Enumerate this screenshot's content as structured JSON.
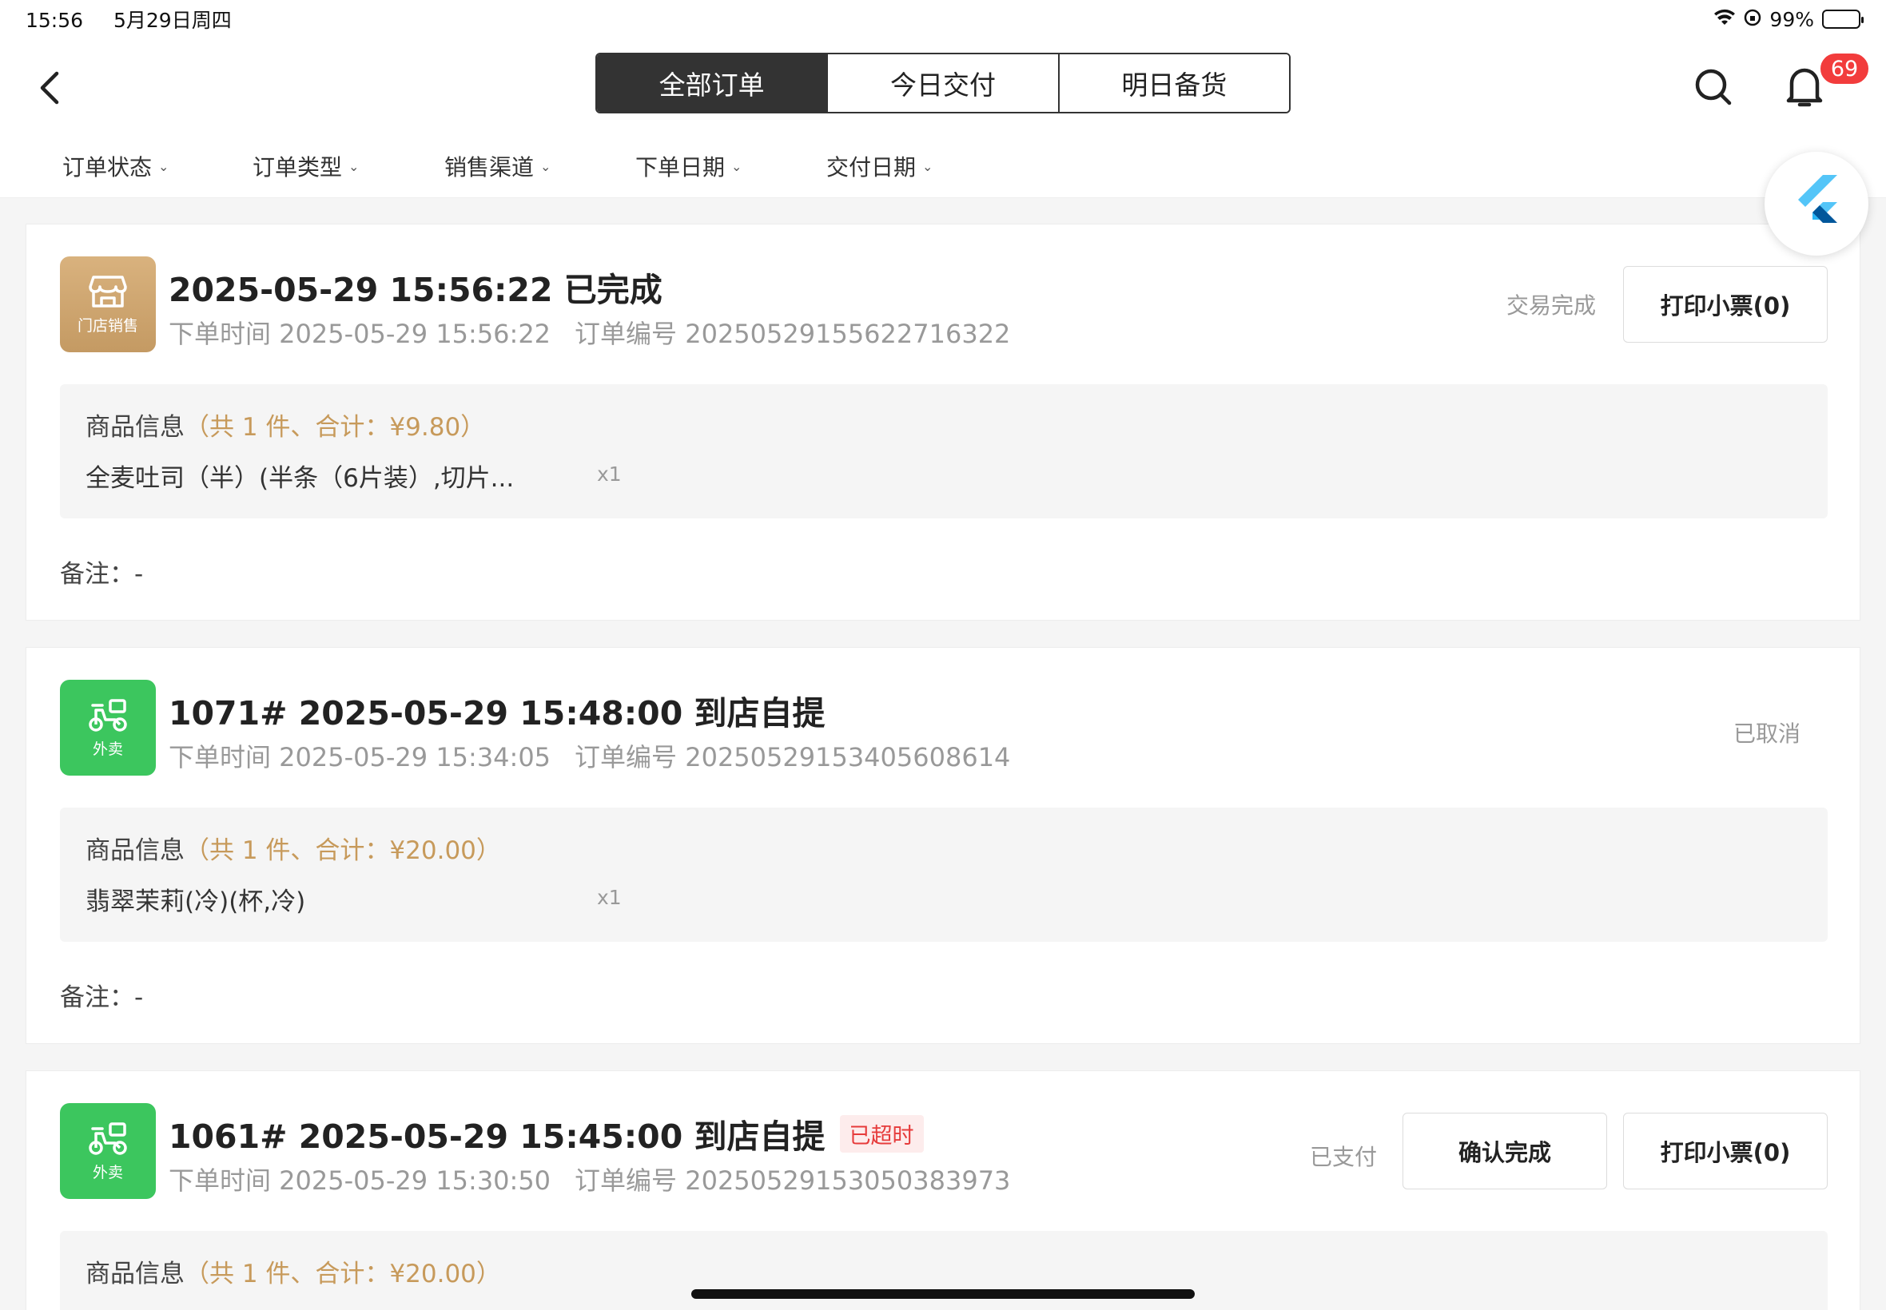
{
  "status_bar": {
    "time": "15:56",
    "date": "5月29日周四",
    "battery": "99%"
  },
  "tabs": [
    {
      "label": "全部订单",
      "active": true
    },
    {
      "label": "今日交付",
      "active": false
    },
    {
      "label": "明日备货",
      "active": false
    }
  ],
  "notification_count": "69",
  "filters": [
    "订单状态",
    "订单类型",
    "销售渠道",
    "下单日期",
    "交付日期"
  ],
  "orders": [
    {
      "type_label": "门店销售",
      "type_icon": "store-icon",
      "title": "2025-05-29 15:56:22 已完成",
      "overdue": "",
      "order_time": "下单时间 2025-05-29 15:56:22",
      "order_no": "订单编号 2025052915562271632​2",
      "status": "交易完成",
      "buttons": [
        "打印小票(0)"
      ],
      "goods_label": "商品信息",
      "goods_summary": "（共 1 件、合计：¥9.80）",
      "item_name": "全麦吐司（半）(半条（6片装）,切片...",
      "item_qty": "x1",
      "remark": "备注：-"
    },
    {
      "type_label": "外卖",
      "type_icon": "delivery-scooter-icon",
      "title": "1071# 2025-05-29 15:48:00 到店自提",
      "overdue": "",
      "order_time": "下单时间 2025-05-29 15:34:05",
      "order_no": "订单编号 2025052915340560861​4",
      "status": "已取消",
      "buttons": [],
      "goods_label": "商品信息",
      "goods_summary": "（共 1 件、合计：¥20.00）",
      "item_name": "翡翠茉莉(冷)(杯,冷)",
      "item_qty": "x1",
      "remark": "备注：-"
    },
    {
      "type_label": "外卖",
      "type_icon": "delivery-scooter-icon",
      "title": "1061# 2025-05-29 15:45:00 到店自提",
      "overdue": "已超时",
      "order_time": "下单时间 2025-05-29 15:30:50",
      "order_no": "订单编号 2025052915305038397​3",
      "status": "已支付",
      "buttons": [
        "确认完成",
        "打印小票(0)"
      ],
      "goods_label": "商品信息",
      "goods_summary": "（共 1 件、合计：¥20.00）",
      "item_name": "",
      "item_qty": "",
      "remark": ""
    }
  ],
  "colors": {
    "accent_dark": "#333333",
    "badge_red": "#f23c3c",
    "store_tile": "#c49a63",
    "takeout_tile": "#3cc65e",
    "summary_gold": "#c79a5b"
  }
}
